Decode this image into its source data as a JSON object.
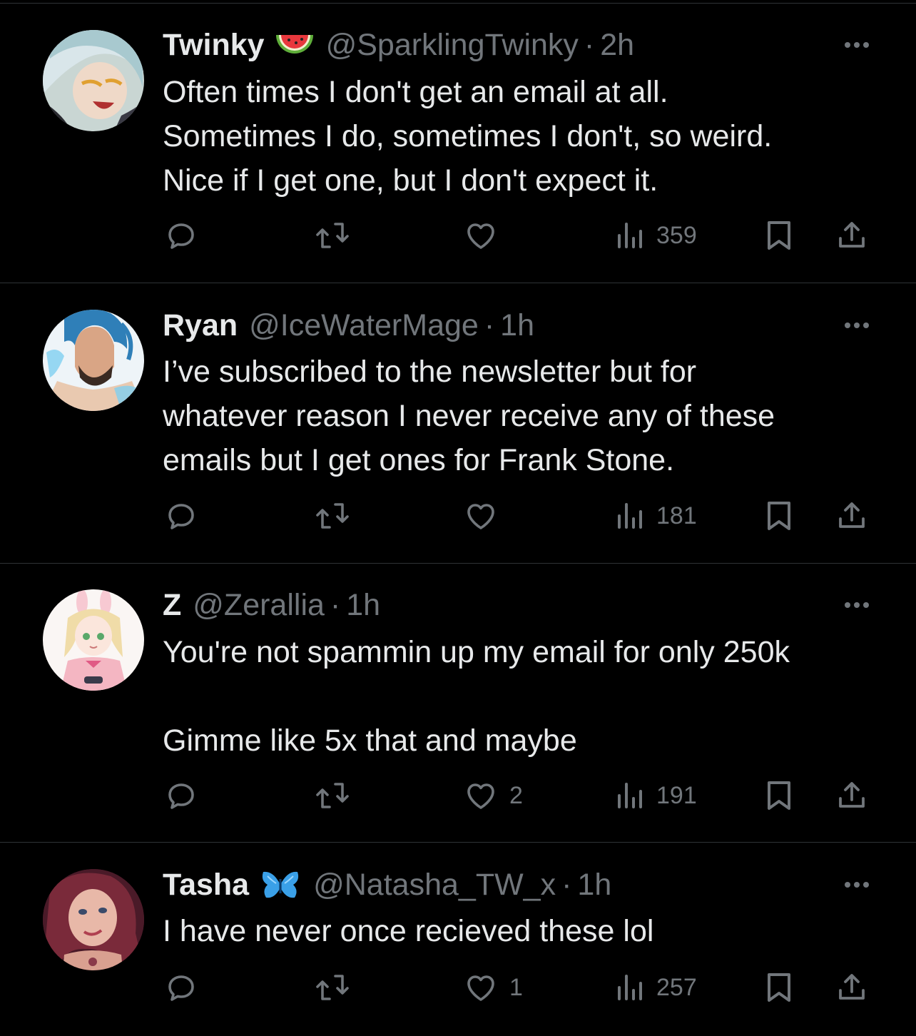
{
  "tweets": [
    {
      "name": "Twinky",
      "name_emoji": "watermelon-emoji",
      "handle": "@SparklingTwinky",
      "separator": "·",
      "time": "2h",
      "text": "Often times I don't get an email at all.\nSometimes I do, sometimes I don't, so weird.\nNice if I get one, but I don't expect it.",
      "replies": "",
      "retweets": "",
      "likes": "",
      "views": "359"
    },
    {
      "name": "Ryan",
      "handle": "@IceWaterMage",
      "separator": "·",
      "time": "1h",
      "text": "I’ve subscribed to the newsletter but for\nwhatever reason I never receive any of these\nemails but I get ones for Frank Stone.",
      "replies": "",
      "retweets": "",
      "likes": "",
      "views": "181"
    },
    {
      "name": "Z",
      "handle": "@Zerallia",
      "separator": "·",
      "time": "1h",
      "text": "You're not spammin up my email for only 250k\n\nGimme like 5x that and maybe",
      "replies": "",
      "retweets": "",
      "likes": "2",
      "views": "191"
    },
    {
      "name": "Tasha",
      "name_emoji": "butterfly-emoji",
      "handle": "@Natasha_TW_x",
      "separator": "·",
      "time": "1h",
      "text": "I have never once recieved these lol",
      "replies": "",
      "retweets": "",
      "likes": "1",
      "views": "257"
    }
  ],
  "icons": {
    "reply": "reply-icon",
    "retweet": "retweet-icon",
    "like": "heart-icon",
    "views": "views-icon",
    "bookmark": "bookmark-icon",
    "share": "share-icon",
    "more": "more-icon"
  },
  "colors": {
    "background": "#000000",
    "text": "#e7e9ea",
    "secondary": "#71767b",
    "divider": "#2f3336"
  }
}
